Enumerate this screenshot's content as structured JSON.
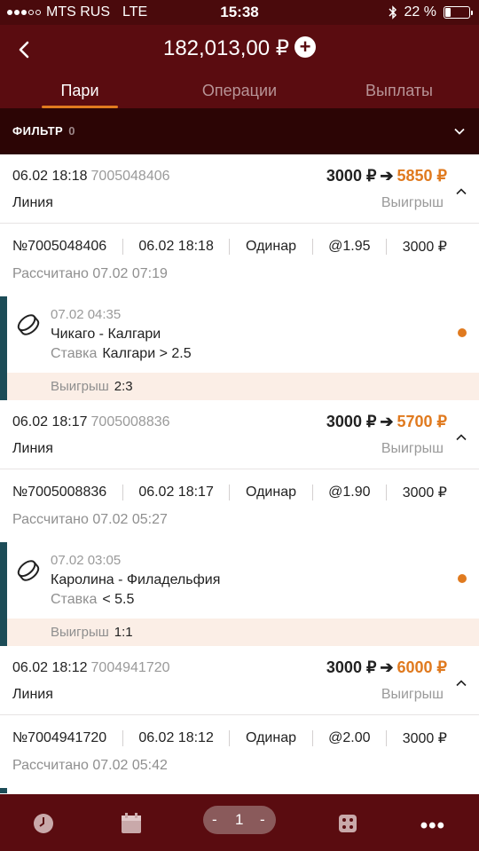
{
  "status_bar": {
    "carrier": "MTS RUS",
    "network": "LTE",
    "time": "15:38",
    "battery_percent": "22 %",
    "battery_level": 0.22
  },
  "header": {
    "balance": "182,013,00 ₽",
    "tabs": [
      "Пари",
      "Операции",
      "Выплаты"
    ],
    "active_tab": "Пари"
  },
  "filter": {
    "label": "ФИЛЬТР",
    "count": "0"
  },
  "bets": [
    {
      "datetime": "06.02 18:18",
      "bet_id": "7005048406",
      "stake": "3000 ₽",
      "win": "5850 ₽",
      "line": "Линия",
      "status": "Выигрыш",
      "number": "№7005048406",
      "placed": "06.02 18:18",
      "type": "Одинар",
      "odds": "@1.95",
      "amount": "3000 ₽",
      "calculated": "Рассчитано 07.02 07:19",
      "event": {
        "time": "07.02 04:35",
        "teams": "Чикаго - Калгари",
        "stake_label": "Ставка",
        "stake_value": "Калгари > 2.5",
        "result_label": "Выигрыш",
        "score": "2:3"
      }
    },
    {
      "datetime": "06.02 18:17",
      "bet_id": "7005008836",
      "stake": "3000 ₽",
      "win": "5700 ₽",
      "line": "Линия",
      "status": "Выигрыш",
      "number": "№7005008836",
      "placed": "06.02 18:17",
      "type": "Одинар",
      "odds": "@1.90",
      "amount": "3000 ₽",
      "calculated": "Рассчитано 07.02 05:27",
      "event": {
        "time": "07.02 03:05",
        "teams": "Каролина - Филадельфия",
        "stake_label": "Ставка",
        "stake_value": "< 5.5",
        "result_label": "Выигрыш",
        "score": "1:1"
      }
    },
    {
      "datetime": "06.02 18:12",
      "bet_id": "7004941720",
      "stake": "3000 ₽",
      "win": "6000 ₽",
      "line": "Линия",
      "status": "Выигрыш",
      "number": "№7004941720",
      "placed": "06.02 18:12",
      "type": "Одинар",
      "odds": "@2.00",
      "amount": "3000 ₽",
      "calculated": "Рассчитано 07.02 05:42"
    }
  ],
  "bottom_bar": {
    "page": "1",
    "minus": "-",
    "plus": "-"
  },
  "colors": {
    "header_bg": "#5a0c10",
    "accent": "#e07a1f",
    "filter_bg": "#2c0505",
    "event_bar": "#1c4c57"
  }
}
